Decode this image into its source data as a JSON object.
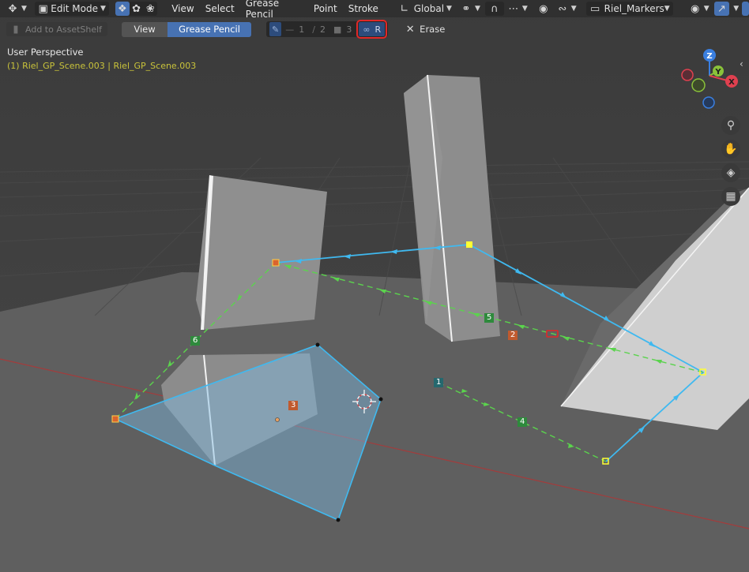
{
  "header": {
    "editor_type_icon": "tool-icon",
    "mode": "Edit Mode",
    "select_mode_icons": [
      "stroke-select-icon",
      "points-select-icon",
      "curve-select-icon"
    ],
    "menus": [
      "View",
      "Select",
      "Grease Pencil",
      "Point",
      "Stroke"
    ],
    "transform_orientation": "Global",
    "object_name": "Riel_Markers"
  },
  "tool_header": {
    "asset_shelf": "Add to AssetShelf",
    "view_tab": "View",
    "grease_pencil_tab": "Grease Pencil",
    "marker_buttons": [
      "1",
      "2",
      "3",
      "R"
    ],
    "erase": "Erase"
  },
  "viewport": {
    "perspective": "User Perspective",
    "object_info": "(1) Riel_GP_Scene.003 | Riel_GP_Scene.003",
    "gizmo_axes": [
      "Z",
      "Y",
      "X"
    ],
    "nav_icons": [
      "zoom-icon",
      "pan-hand-icon",
      "camera-icon",
      "ortho-grid-icon"
    ]
  },
  "labels": [
    "1",
    "2",
    "3",
    "4",
    "5",
    "6"
  ],
  "colors": {
    "active_blue": "#4772b3",
    "stroke_cyan": "#3fb9f0",
    "dash_green": "#5bd34d",
    "marker_orange": "#d9642e",
    "highlight_red": "#e02828",
    "axis_x": "#e0404f",
    "axis_y": "#8ac23a",
    "axis_z": "#3a7fe0"
  }
}
